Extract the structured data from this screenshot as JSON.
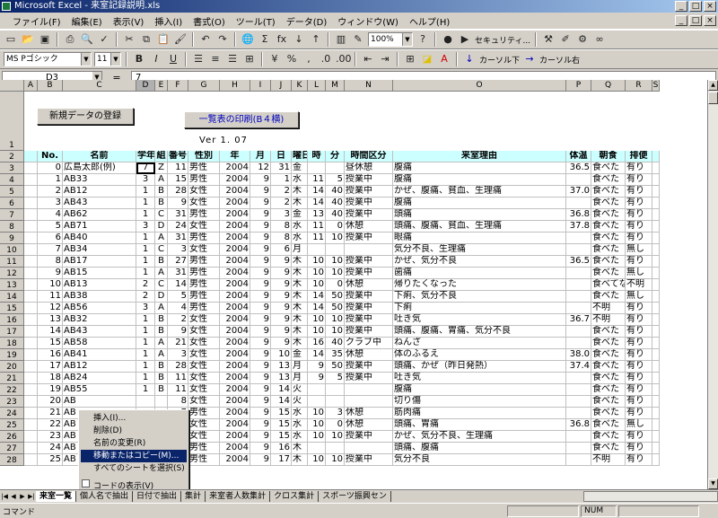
{
  "window": {
    "title": "Microsoft Excel - 来室記録説明.xls",
    "min": "_",
    "max": "□",
    "close": "×"
  },
  "menu": [
    "ファイル(F)",
    "編集(E)",
    "表示(V)",
    "挿入(I)",
    "書式(O)",
    "ツール(T)",
    "データ(D)",
    "ウィンドウ(W)",
    "ヘルプ(H)"
  ],
  "toolbar1": {
    "zoom": "100%",
    "security": "セキュリティ...",
    "icons": [
      "new-icon",
      "open-icon",
      "save-icon",
      "print-icon",
      "preview-icon",
      "spell-icon",
      "cut-icon",
      "copy-icon",
      "paste-icon",
      "format-painter-icon",
      "undo-icon",
      "redo-icon",
      "hyperlink-icon",
      "autosum-icon",
      "function-icon",
      "sort-asc-icon",
      "sort-desc-icon",
      "chart-icon",
      "drawing-icon",
      "help-icon",
      "record-icon"
    ]
  },
  "toolbar2": {
    "font": "MS Pゴシック",
    "size": "11",
    "bold": "B",
    "italic": "I",
    "underline": "U",
    "cursor_down": "カーソル下",
    "cursor_right": "カーソル右"
  },
  "formula": {
    "name_box": "D3",
    "eq": "=",
    "value": "7"
  },
  "columns": [
    {
      "l": "",
      "w": 27
    },
    {
      "l": "A",
      "w": 15
    },
    {
      "l": "B",
      "w": 28
    },
    {
      "l": "C",
      "w": 82
    },
    {
      "l": "D",
      "w": 21
    },
    {
      "l": "E",
      "w": 14
    },
    {
      "l": "F",
      "w": 23
    },
    {
      "l": "G",
      "w": 35
    },
    {
      "l": "H",
      "w": 34
    },
    {
      "l": "I",
      "w": 23
    },
    {
      "l": "J",
      "w": 23
    },
    {
      "l": "K",
      "w": 18
    },
    {
      "l": "L",
      "w": 20
    },
    {
      "l": "M",
      "w": 21
    },
    {
      "l": "N",
      "w": 54
    },
    {
      "l": "O",
      "w": 193
    },
    {
      "l": "P",
      "w": 28
    },
    {
      "l": "Q",
      "w": 38
    },
    {
      "l": "R",
      "w": 30
    },
    {
      "l": "S",
      "w": 8
    }
  ],
  "buttons": {
    "register": "新規データの登録",
    "print": "一覧表の印刷(B４横)"
  },
  "version": "Ver 1. 07",
  "headers": [
    "No.",
    "名前",
    "学年",
    "組",
    "番号",
    "性別",
    "年",
    "月",
    "日",
    "曜日",
    "時",
    "分",
    "時間区分",
    "来室理由",
    "体温",
    "朝食",
    "排便"
  ],
  "rows": [
    {
      "n": "3",
      "v": [
        "0",
        "広島太郎(例)",
        "7",
        "Z",
        "11",
        "男性",
        "2004",
        "12",
        "31",
        "金",
        "",
        "",
        "昼休憩",
        "腹痛",
        "36.5",
        "食べた",
        "有り"
      ]
    },
    {
      "n": "4",
      "v": [
        "1",
        "AB33",
        "3",
        "A",
        "15",
        "男性",
        "2004",
        "9",
        "1",
        "水",
        "11",
        "5",
        "授業中",
        "腹痛",
        "",
        "食べた",
        "有り"
      ]
    },
    {
      "n": "5",
      "v": [
        "2",
        "AB12",
        "1",
        "B",
        "28",
        "女性",
        "2004",
        "9",
        "2",
        "木",
        "14",
        "40",
        "授業中",
        "かぜ、腹痛、貧血、生理痛",
        "37.0",
        "食べた",
        "有り"
      ]
    },
    {
      "n": "6",
      "v": [
        "3",
        "AB43",
        "1",
        "B",
        "9",
        "女性",
        "2004",
        "9",
        "2",
        "木",
        "14",
        "40",
        "授業中",
        "腹痛",
        "",
        "食べた",
        "有り"
      ]
    },
    {
      "n": "7",
      "v": [
        "4",
        "AB62",
        "1",
        "C",
        "31",
        "男性",
        "2004",
        "9",
        "3",
        "金",
        "13",
        "40",
        "授業中",
        "頭痛",
        "36.8",
        "食べた",
        "有り"
      ]
    },
    {
      "n": "8",
      "v": [
        "5",
        "AB71",
        "3",
        "D",
        "24",
        "女性",
        "2004",
        "9",
        "8",
        "水",
        "11",
        "0",
        "休憩",
        "頭痛、腹痛、貧血、生理痛",
        "37.8",
        "食べた",
        "有り"
      ]
    },
    {
      "n": "9",
      "v": [
        "6",
        "AB40",
        "1",
        "A",
        "31",
        "男性",
        "2004",
        "9",
        "8",
        "水",
        "11",
        "10",
        "授業中",
        "眼痛",
        "",
        "食べた",
        "有り"
      ]
    },
    {
      "n": "10",
      "v": [
        "7",
        "AB34",
        "1",
        "C",
        "3",
        "女性",
        "2004",
        "9",
        "6",
        "月",
        "",
        "",
        "",
        "気分不良、生理痛",
        "",
        "食べた",
        "無し"
      ]
    },
    {
      "n": "11",
      "v": [
        "8",
        "AB17",
        "1",
        "B",
        "27",
        "男性",
        "2004",
        "9",
        "9",
        "木",
        "10",
        "10",
        "授業中",
        "かぜ、気分不良",
        "36.5",
        "食べた",
        "有り"
      ]
    },
    {
      "n": "12",
      "v": [
        "9",
        "AB15",
        "1",
        "A",
        "31",
        "男性",
        "2004",
        "9",
        "9",
        "木",
        "10",
        "10",
        "授業中",
        "歯痛",
        "",
        "食べた",
        "無し"
      ]
    },
    {
      "n": "13",
      "v": [
        "10",
        "AB13",
        "2",
        "C",
        "14",
        "男性",
        "2004",
        "9",
        "9",
        "木",
        "10",
        "0",
        "休憩",
        "帰りたくなった",
        "",
        "食べてな",
        "不明"
      ]
    },
    {
      "n": "14",
      "v": [
        "11",
        "AB38",
        "2",
        "D",
        "5",
        "男性",
        "2004",
        "9",
        "9",
        "木",
        "14",
        "50",
        "授業中",
        "下痢、気分不良",
        "",
        "食べた",
        "無し"
      ]
    },
    {
      "n": "15",
      "v": [
        "12",
        "AB56",
        "3",
        "A",
        "4",
        "男性",
        "2004",
        "9",
        "9",
        "木",
        "14",
        "50",
        "授業中",
        "下痢",
        "",
        "不明",
        "有り"
      ]
    },
    {
      "n": "16",
      "v": [
        "13",
        "AB32",
        "1",
        "B",
        "2",
        "女性",
        "2004",
        "9",
        "9",
        "木",
        "10",
        "10",
        "授業中",
        "吐き気",
        "36.7",
        "不明",
        "有り"
      ]
    },
    {
      "n": "17",
      "v": [
        "14",
        "AB43",
        "1",
        "B",
        "9",
        "女性",
        "2004",
        "9",
        "9",
        "木",
        "10",
        "10",
        "授業中",
        "頭痛、腹痛、胃痛、気分不良",
        "",
        "食べた",
        "有り"
      ]
    },
    {
      "n": "18",
      "v": [
        "15",
        "AB58",
        "1",
        "A",
        "21",
        "女性",
        "2004",
        "9",
        "9",
        "木",
        "16",
        "40",
        "クラブ中",
        "ねんざ",
        "",
        "食べた",
        "有り"
      ]
    },
    {
      "n": "19",
      "v": [
        "16",
        "AB41",
        "1",
        "A",
        "3",
        "女性",
        "2004",
        "9",
        "10",
        "金",
        "14",
        "35",
        "休憩",
        "体のふるえ",
        "38.0",
        "食べた",
        "有り"
      ]
    },
    {
      "n": "20",
      "v": [
        "17",
        "AB12",
        "1",
        "B",
        "28",
        "女性",
        "2004",
        "9",
        "13",
        "月",
        "9",
        "50",
        "授業中",
        "頭痛、かぜ（昨日発熱）",
        "37.4",
        "食べた",
        "有り"
      ]
    },
    {
      "n": "21",
      "v": [
        "18",
        "AB24",
        "1",
        "B",
        "11",
        "女性",
        "2004",
        "9",
        "13",
        "月",
        "9",
        "5",
        "授業中",
        "吐き気",
        "",
        "食べた",
        "有り"
      ]
    },
    {
      "n": "22",
      "v": [
        "19",
        "AB55",
        "1",
        "B",
        "11",
        "女性",
        "2004",
        "9",
        "14",
        "火",
        "",
        "",
        "",
        "腹痛",
        "",
        "食べた",
        "有り"
      ]
    },
    {
      "n": "23",
      "v": [
        "20",
        "AB",
        "",
        "",
        "8",
        "女性",
        "2004",
        "9",
        "14",
        "火",
        "",
        "",
        "",
        "切り傷",
        "",
        "食べた",
        "有り"
      ]
    },
    {
      "n": "24",
      "v": [
        "21",
        "AB",
        "",
        "",
        "7",
        "男性",
        "2004",
        "9",
        "15",
        "水",
        "10",
        "3",
        "休憩",
        "筋肉痛",
        "",
        "食べた",
        "有り"
      ]
    },
    {
      "n": "25",
      "v": [
        "22",
        "AB",
        "",
        "",
        "",
        "女性",
        "2004",
        "9",
        "15",
        "水",
        "10",
        "0",
        "休憩",
        "頭痛、胃痛",
        "36.8",
        "食べた",
        "無し"
      ]
    },
    {
      "n": "26",
      "v": [
        "23",
        "AB",
        "",
        "",
        "2",
        "女性",
        "2004",
        "9",
        "15",
        "水",
        "10",
        "10",
        "授業中",
        "かぜ、気分不良、生理痛",
        "",
        "食べた",
        "有り"
      ]
    },
    {
      "n": "27",
      "v": [
        "24",
        "AB",
        "",
        "",
        "",
        "男性",
        "2004",
        "9",
        "16",
        "木",
        "",
        "",
        "",
        "頭痛、腹痛",
        "",
        "食べた",
        "有り"
      ]
    },
    {
      "n": "28",
      "v": [
        "25",
        "AB",
        "",
        "",
        "",
        "男性",
        "2004",
        "9",
        "17",
        "木",
        "10",
        "10",
        "授業中",
        "気分不良",
        "",
        "不明",
        "有り"
      ]
    }
  ],
  "context_menu": {
    "items": [
      "挿入(I)...",
      "削除(D)",
      "名前の変更(R)",
      "移動またはコピー(M)...",
      "すべてのシートを選択(S)",
      "コードの表示(V)"
    ],
    "highlighted": 3
  },
  "tabs": [
    "来室一覧",
    "個人名で抽出",
    "日付で抽出",
    "集計",
    "来室者人数集計",
    "クロス集計",
    "スポーツ振興セン"
  ],
  "status": {
    "mode": "コマンド",
    "num": "NUM"
  }
}
